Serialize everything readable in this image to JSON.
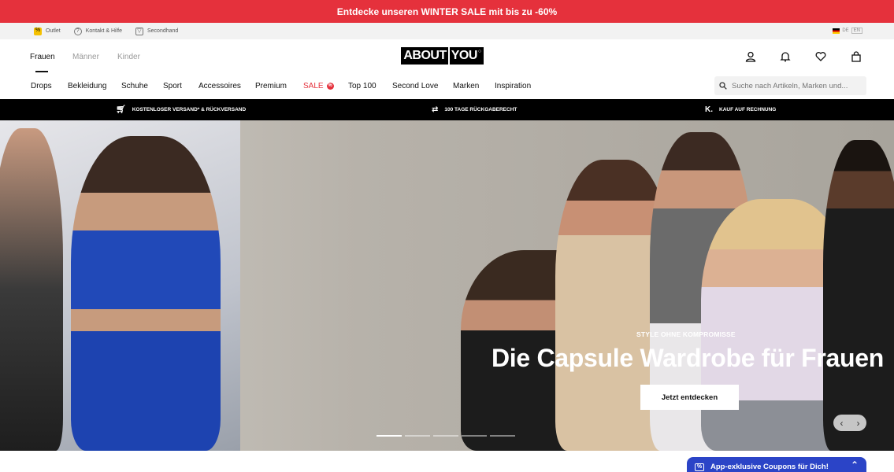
{
  "promo_banner": {
    "text": "Entdecke unseren WINTER SALE mit bis zu -60%"
  },
  "utility_bar": {
    "items": [
      {
        "label": "Outlet",
        "icon": "percent-icon"
      },
      {
        "label": "Kontakt & Hilfe",
        "icon": "help-icon"
      },
      {
        "label": "Secondhand",
        "icon": "shirt-icon"
      }
    ],
    "language": "DE",
    "language_toggle": "EN"
  },
  "header": {
    "genders": [
      "Frauen",
      "Männer",
      "Kinder"
    ],
    "active_gender": "Frauen",
    "logo": {
      "left": "ABOUT",
      "right": "YOU"
    },
    "icons": [
      "user-icon",
      "bell-icon",
      "heart-icon",
      "bag-icon"
    ]
  },
  "category_nav": {
    "items": [
      "Drops",
      "Bekleidung",
      "Schuhe",
      "Sport",
      "Accessoires",
      "Premium",
      "SALE",
      "Top 100",
      "Second Love",
      "Marken",
      "Inspiration"
    ],
    "sale_badge": "%"
  },
  "search": {
    "placeholder": "Suche nach Artikeln, Marken und..."
  },
  "benefits": [
    {
      "label": "KOSTENLOSER VERSAND* & RÜCKVERSAND",
      "icon": "cart-icon"
    },
    {
      "label": "100 TAGE RÜCKGABERECHT",
      "icon": "swap-icon"
    },
    {
      "label": "KAUF AUF RECHNUNG",
      "icon": "klarna-icon"
    }
  ],
  "hero": {
    "eyebrow": "STYLE OHNE KOMPROMISSE",
    "headline": "Die Capsule Wardrobe für Frauen",
    "cta": "Jetzt entdecken",
    "slides_total": 5,
    "active_slide": 1
  },
  "coupon_bar": {
    "text": "App-exklusive Coupons für Dich!"
  },
  "colors": {
    "promo": "#e5313c",
    "sale": "#e5313c",
    "coupon": "#2b44c7"
  }
}
